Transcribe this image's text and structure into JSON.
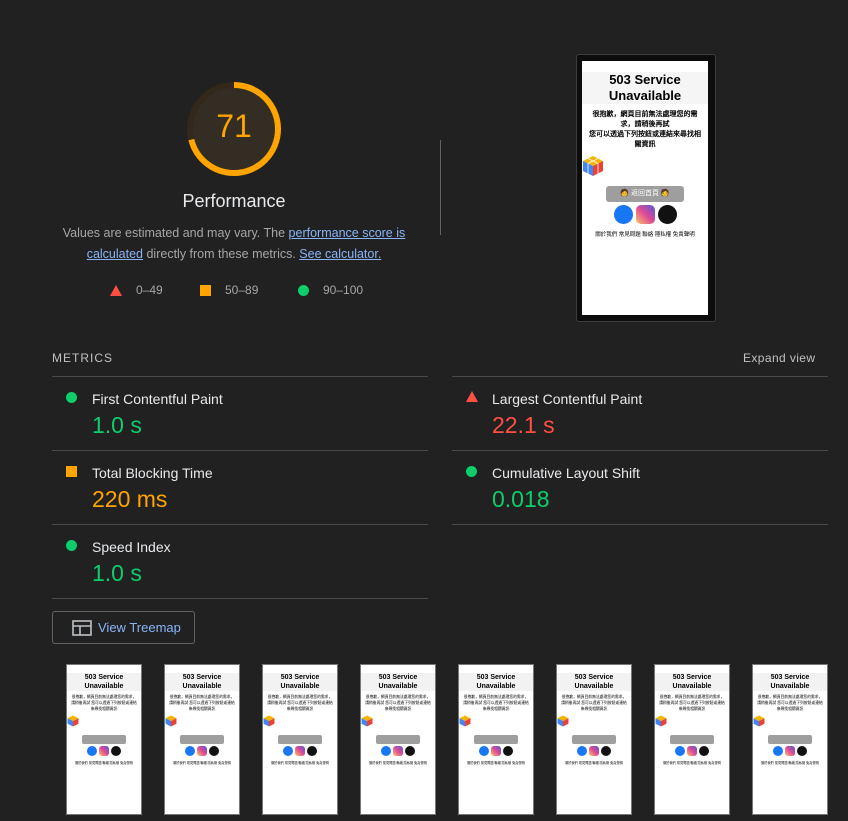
{
  "score": {
    "value": "71",
    "level": 71,
    "label": "Performance",
    "color": "#ffa400",
    "desc_prefix": "Values are estimated and may vary. The ",
    "desc_link1": "performance score is calculated",
    "desc_middle": " directly from these metrics. ",
    "desc_link2": "See calculator."
  },
  "legend": [
    {
      "shape": "triangle",
      "color": "#ff4e42",
      "range": "0–49"
    },
    {
      "shape": "square",
      "color": "#ffa400",
      "range": "50–89"
    },
    {
      "shape": "circle",
      "color": "#0cce6b",
      "range": "90–100"
    }
  ],
  "preview": {
    "title": "503 Service Unavailable",
    "line1": "很抱歉，網頁目前無法處理您的需求，請稍後再試",
    "line2": "您可以透過下列按鈕或連結來尋找相關資訊",
    "button": "🧑 返回首頁 🧑",
    "footer": "關於我們 常見問題 聯絡 隱私權 免責聲明",
    "icons": [
      "facebook-icon",
      "instagram-icon",
      "github-icon"
    ]
  },
  "metrics": {
    "title": "METRICS",
    "expand": "Expand view",
    "items": [
      {
        "name": "First Contentful Paint",
        "value": "1.0 s",
        "status": "circle",
        "color": "#0cce6b"
      },
      {
        "name": "Largest Contentful Paint",
        "value": "22.1 s",
        "status": "triangle",
        "color": "#ff4e42"
      },
      {
        "name": "Total Blocking Time",
        "value": "220 ms",
        "status": "square",
        "color": "#ffa400"
      },
      {
        "name": "Cumulative Layout Shift",
        "value": "0.018",
        "status": "circle",
        "color": "#0cce6b"
      },
      {
        "name": "Speed Index",
        "value": "1.0 s",
        "status": "circle",
        "color": "#0cce6b"
      }
    ]
  },
  "treemap_button": "View Treemap",
  "filmstrip": {
    "count": 8,
    "title": "503 Service Unavailable"
  }
}
